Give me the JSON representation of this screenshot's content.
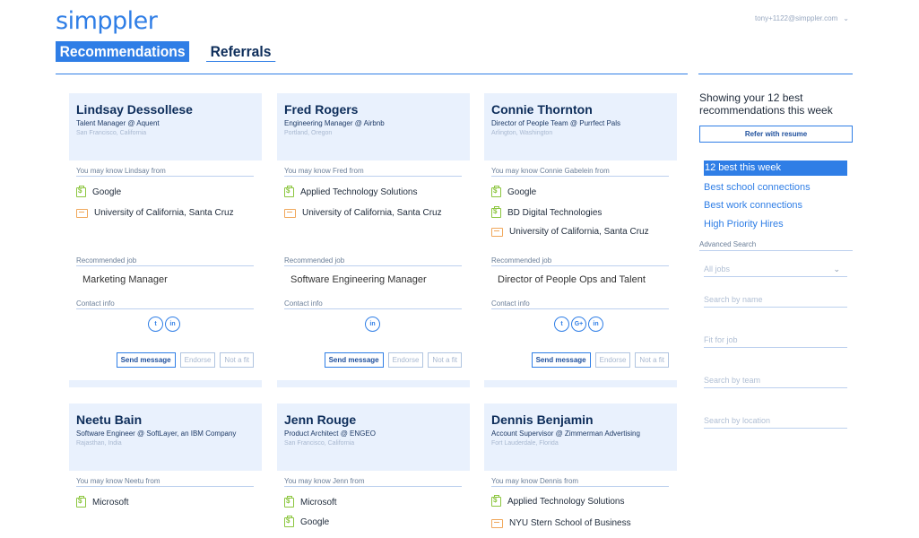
{
  "app": {
    "logo": "simppler",
    "user_email": "tony+1122@simppler.com"
  },
  "tabs": [
    {
      "label": "Recommendations"
    },
    {
      "label": "Referrals"
    }
  ],
  "labels": {
    "recommended_job": "Recommended job",
    "contact_info": "Contact info",
    "send_message": "Send message",
    "endorse": "Endorse",
    "not_a_fit": "Not a fit"
  },
  "cards": [
    {
      "name": "Lindsay Dessollese",
      "title": "Talent Manager @ Aquent",
      "location": "San Francisco, California",
      "know_from": "You may know Lindsay from",
      "connections": [
        {
          "type": "company",
          "label": "Google"
        },
        {
          "type": "school",
          "label": "University of California, Santa Cruz"
        }
      ],
      "job": "Marketing Manager",
      "social": [
        "twitter",
        "linkedin"
      ]
    },
    {
      "name": "Fred Rogers",
      "title": "Engineering Manager @ Airbnb",
      "location": "Portland, Oregon",
      "know_from": "You may know Fred from",
      "connections": [
        {
          "type": "company",
          "label": "Applied Technology Solutions"
        },
        {
          "type": "school",
          "label": "University of California, Santa Cruz"
        }
      ],
      "job": "Software Engineering Manager",
      "social": [
        "linkedin"
      ]
    },
    {
      "name": "Connie Thornton",
      "title": "Director of People Team @ Purrfect Pals",
      "location": "Arlington, Washington",
      "know_from": "You may know Connie Gabelein from",
      "connections": [
        {
          "type": "company",
          "label": "Google"
        },
        {
          "type": "company",
          "label": "BD Digital Technologies"
        },
        {
          "type": "school",
          "label": "University of California, Santa Cruz"
        }
      ],
      "job": "Director of People Ops and Talent",
      "social": [
        "twitter",
        "googleplus",
        "linkedin"
      ]
    },
    {
      "name": "Neetu Bain",
      "title": "Software Engineer @ SoftLayer, an IBM Company",
      "location": "Rajasthan, India",
      "know_from": "You may know Neetu from",
      "connections": [
        {
          "type": "company",
          "label": "Microsoft"
        }
      ]
    },
    {
      "name": "Jenn Rouge",
      "title": "Product Architect @ ENGEO",
      "location": "San Francisco, California",
      "know_from": "You may know Jenn from",
      "connections": [
        {
          "type": "company",
          "label": "Microsoft"
        },
        {
          "type": "company",
          "label": "Google"
        }
      ]
    },
    {
      "name": "Dennis Benjamin",
      "title": "Account Supervisor @ Zimmerman Advertising",
      "location": "Fort Lauderdale, Florida",
      "know_from": "You may know Dennis from",
      "connections": [
        {
          "type": "company",
          "label": "Applied Technology Solutions"
        },
        {
          "type": "school",
          "label": "NYU Stern School of Business"
        }
      ]
    }
  ],
  "sidebar": {
    "title": "Showing your 12 best recommendations this week",
    "refer_button": "Refer with resume",
    "filters": [
      "12 best this week",
      "Best school connections",
      "Best work connections",
      "High Priority Hires"
    ],
    "advanced_label": "Advanced Search",
    "jobs_select": "All jobs",
    "search_name": "Search by name",
    "fit_for_job": "Fit for job",
    "search_team": "Search by team",
    "search_location": "Search by location"
  },
  "colors": {
    "accent": "#2f7ee6",
    "card_bg": "#e9f1fd",
    "company_icon": "#8cc63f",
    "school_icon": "#f0a75a"
  }
}
